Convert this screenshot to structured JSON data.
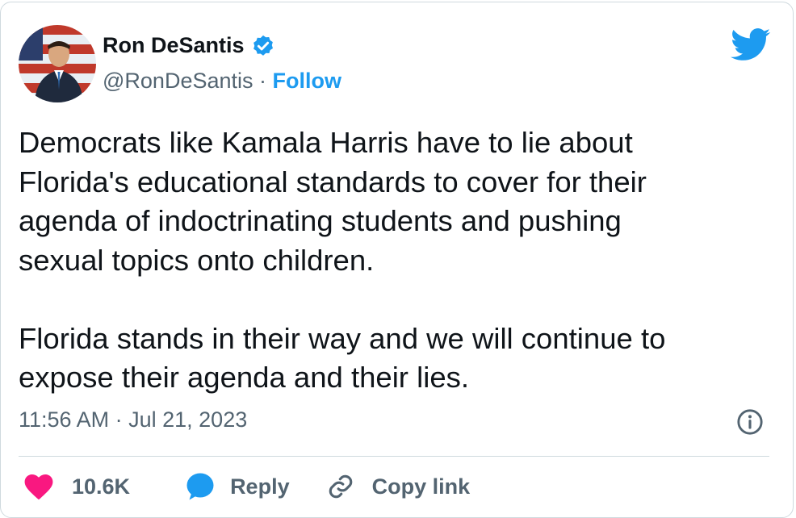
{
  "tweet": {
    "author_name": "Ron DeSantis",
    "handle": "@RonDeSantis",
    "separator": "·",
    "follow_label": "Follow",
    "text": "Democrats like Kamala Harris have to lie about\nFlorida's educational standards to cover for their\nagenda of indoctrinating students and pushing\nsexual topics onto children.\n\nFlorida stands in their way and we will continue to\nexpose their agenda and their lies.",
    "time": "11:56 AM",
    "date": "Jul 21, 2023",
    "meta_separator": "·"
  },
  "actions": {
    "likes_count": "10.6K",
    "reply_label": "Reply",
    "copy_link_label": "Copy link"
  },
  "icons": {
    "avatar": "avatar",
    "verified": "verified-badge-icon",
    "logo": "twitter-bird-icon",
    "info": "info-icon",
    "like": "heart-icon",
    "reply": "reply-bubble-icon",
    "link": "link-icon"
  },
  "colors": {
    "accent": "#1d9bf0",
    "text": "#0f1419",
    "muted": "#536471",
    "like": "#f91880",
    "border": "#cfd9de"
  }
}
